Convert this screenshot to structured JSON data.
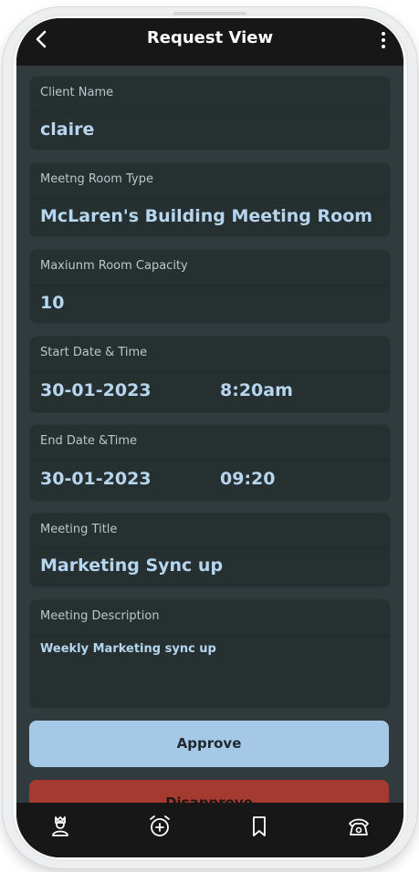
{
  "header": {
    "title": "Request View",
    "back_icon": "chevron-left-icon",
    "more_icon": "more-vert-icon"
  },
  "fields": {
    "client_name": {
      "label": "Client Name",
      "value": "claire"
    },
    "room_type": {
      "label": "Meetng Room Type",
      "value": "McLaren's Building Meeting Room"
    },
    "capacity": {
      "label": "Maxiunm Room Capacity",
      "value": "10"
    },
    "start": {
      "label": "Start Date & Time",
      "date": "30-01-2023",
      "time": "8:20am"
    },
    "end": {
      "label": "End Date &Time",
      "date": "30-01-2023",
      "time": "09:20"
    },
    "title": {
      "label": "Meeting Title",
      "value": "Marketing Sync up"
    },
    "description": {
      "label": "Meeting Description",
      "value": "Weekly Marketing sync up"
    }
  },
  "actions": {
    "approve_label": "Approve",
    "disapprove_label": "Disapprove"
  },
  "bottom_nav": {
    "items": [
      "person-icon",
      "alarm-add-icon",
      "bookmark-icon",
      "phone-icon"
    ]
  },
  "colors": {
    "background": "#171717",
    "card": "#273031",
    "content": "#313b3d",
    "value_text": "#b6d5ee",
    "approve": "#a4c8e6",
    "disapprove": "#a53a31"
  }
}
